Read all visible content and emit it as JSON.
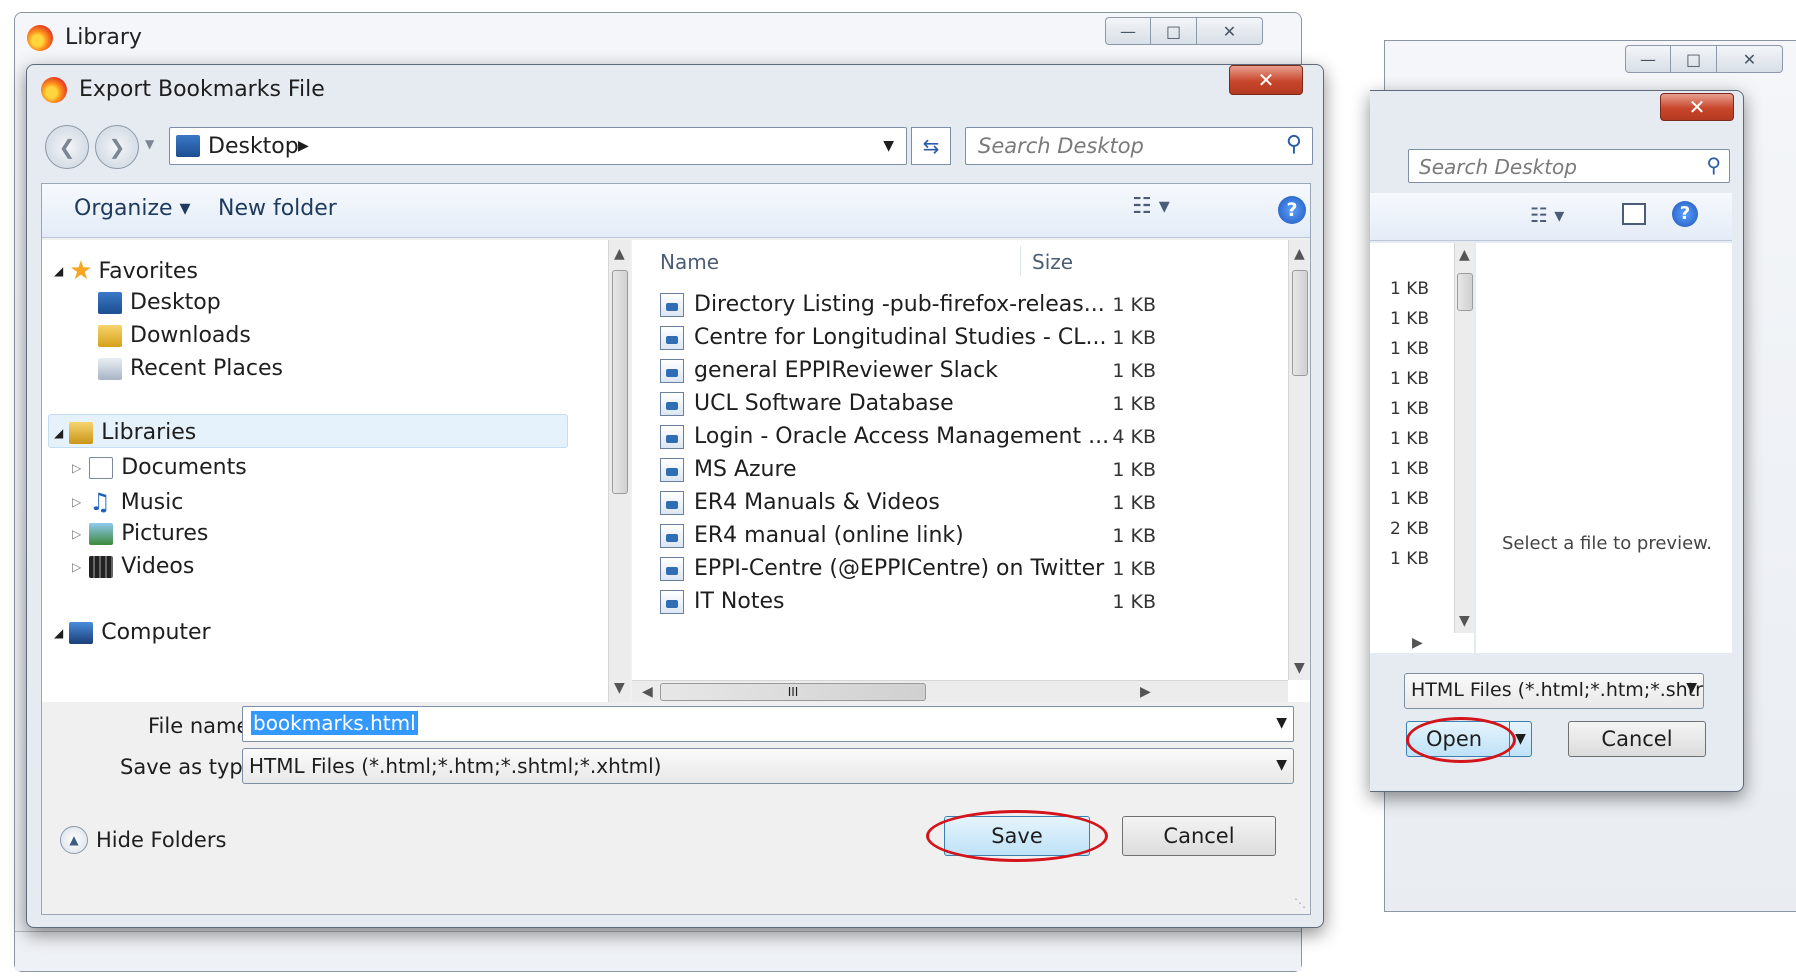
{
  "library": {
    "title": "Library"
  },
  "export_dialog": {
    "title": "Export Bookmarks File",
    "breadcrumb": "Desktop",
    "search_placeholder": "Search Desktop",
    "toolbar": {
      "organize": "Organize",
      "new_folder": "New folder"
    },
    "nav": {
      "favorites": "Favorites",
      "desktop": "Desktop",
      "downloads": "Downloads",
      "recent_places": "Recent Places",
      "libraries": "Libraries",
      "documents": "Documents",
      "music": "Music",
      "pictures": "Pictures",
      "videos": "Videos",
      "computer": "Computer"
    },
    "columns": {
      "name": "Name",
      "size": "Size"
    },
    "files": [
      {
        "name": "Directory Listing -pub-firefox-releas...",
        "size": "1 KB"
      },
      {
        "name": "Centre for Longitudinal Studies - CL...",
        "size": "1 KB"
      },
      {
        "name": "general  EPPIReviewer Slack",
        "size": "1 KB"
      },
      {
        "name": "UCL Software Database",
        "size": "1 KB"
      },
      {
        "name": "Login - Oracle Access Management ...",
        "size": "4 KB"
      },
      {
        "name": "MS Azure",
        "size": "1 KB"
      },
      {
        "name": "ER4 Manuals & Videos",
        "size": "1 KB"
      },
      {
        "name": "ER4 manual (online link)",
        "size": "1 KB"
      },
      {
        "name": "EPPI-Centre (@EPPICentre) on Twitter",
        "size": "1 KB"
      },
      {
        "name": "IT Notes",
        "size": "1 KB"
      }
    ],
    "file_name_label": "File name:",
    "file_name_value": "bookmarks.html",
    "save_type_label": "Save as type:",
    "save_type_value": "HTML Files (*.html;*.htm;*.shtml;*.xhtml)",
    "hide_folders": "Hide Folders",
    "save": "Save",
    "cancel": "Cancel",
    "scroll_grip": "III"
  },
  "import_dialog": {
    "search_placeholder": "Search Desktop",
    "sizes": [
      "1 KB",
      "1 KB",
      "1 KB",
      "1 KB",
      "1 KB",
      "1 KB",
      "1 KB",
      "1 KB",
      "2 KB",
      "1 KB"
    ],
    "preview_text": "Select a file to preview.",
    "filter_value": "HTML Files (*.html;*.htm;*.shtr",
    "open": "Open",
    "cancel": "Cancel"
  },
  "colors": {
    "highlight_ring": "#d3141a",
    "selection": "#3399ff",
    "title_close": "#c8462b"
  }
}
